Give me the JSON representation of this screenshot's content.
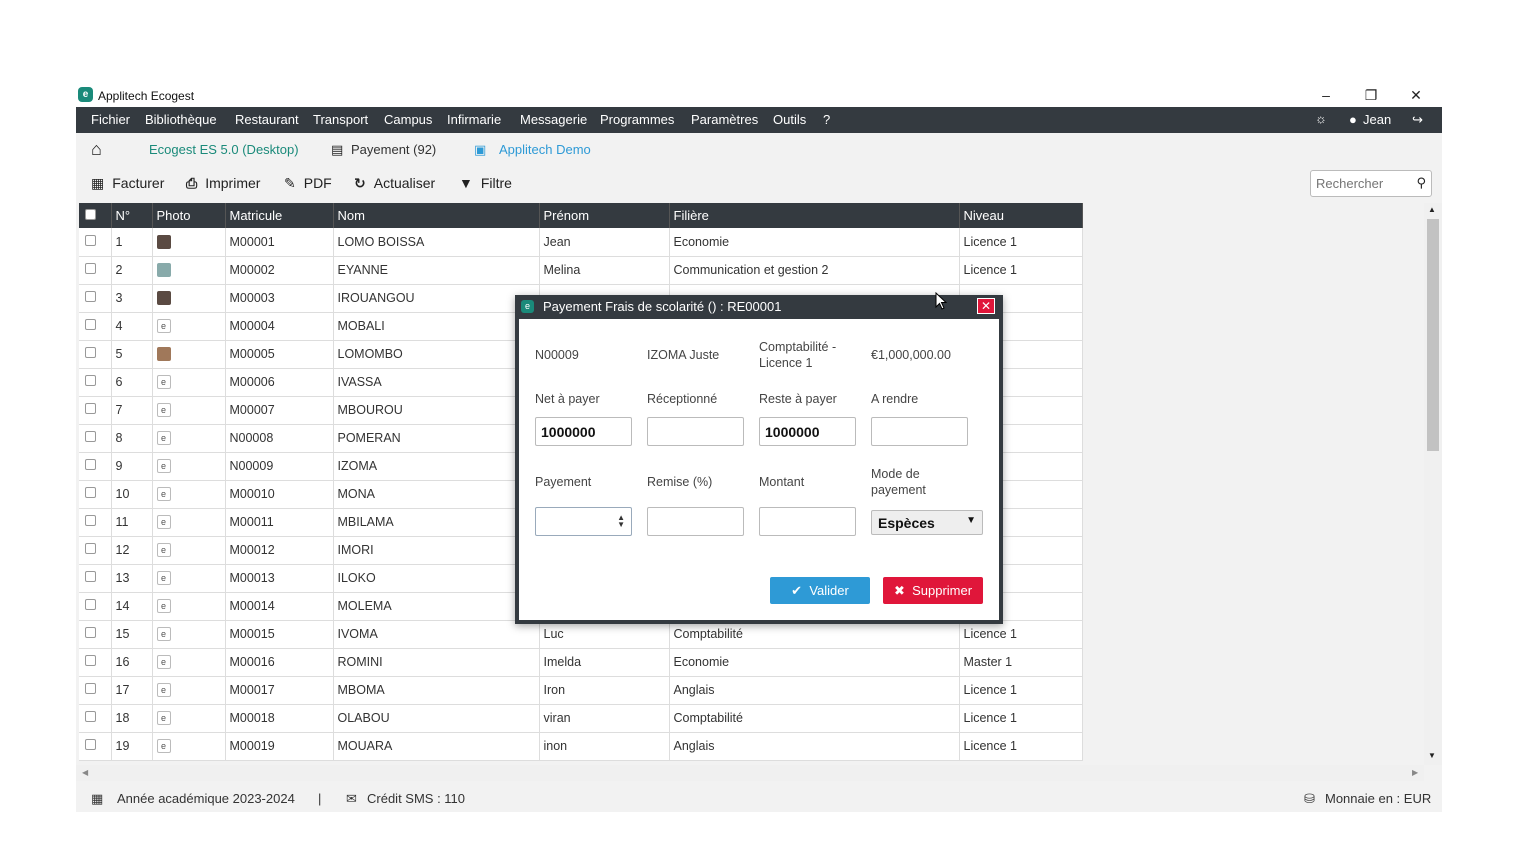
{
  "window": {
    "title": "Applitech Ecogest",
    "icon": "app-logo-icon",
    "controls": [
      "minimize-icon",
      "restore-icon",
      "close-icon"
    ]
  },
  "menu": {
    "items": [
      "Fichier",
      "Bibliothèque",
      "Restaurant",
      "Transport",
      "Campus",
      "Infirmarie",
      "Messagerie",
      "Programmes",
      "Paramètres",
      "Outils",
      "?"
    ],
    "user": "Jean"
  },
  "breadcrumbs": {
    "app": "Ecogest ES 5.0 (Desktop)",
    "section": "Payement (92)",
    "org": "Applitech Demo"
  },
  "toolbar": {
    "facturer": "Facturer",
    "imprimer": "Imprimer",
    "pdf": "PDF",
    "actualiser": "Actualiser",
    "filtre": "Filtre",
    "search_placeholder": "Rechercher"
  },
  "table": {
    "headers": [
      "N°",
      "Photo",
      "Matricule",
      "Nom",
      "Prénom",
      "Filière",
      "Niveau"
    ],
    "rows": [
      {
        "n": "1",
        "photo": "a",
        "matricule": "M00001",
        "nom": "LOMO BOISSA",
        "prenom": "Jean",
        "filiere": "Economie",
        "niveau": "Licence 1"
      },
      {
        "n": "2",
        "photo": "b",
        "matricule": "M00002",
        "nom": "EYANNE",
        "prenom": "Melina",
        "filiere": "Communication et gestion 2",
        "niveau": "Licence 1"
      },
      {
        "n": "3",
        "photo": "a",
        "matricule": "M00003",
        "nom": "IROUANGOU",
        "prenom": "",
        "filiere": "",
        "niveau": ""
      },
      {
        "n": "4",
        "photo": "d",
        "matricule": "M00004",
        "nom": "MOBALI",
        "prenom": "",
        "filiere": "",
        "niveau": ""
      },
      {
        "n": "5",
        "photo": "c",
        "matricule": "M00005",
        "nom": "LOMOMBO",
        "prenom": "",
        "filiere": "",
        "niveau": ""
      },
      {
        "n": "6",
        "photo": "d",
        "matricule": "M00006",
        "nom": "IVASSA",
        "prenom": "",
        "filiere": "",
        "niveau": ""
      },
      {
        "n": "7",
        "photo": "d",
        "matricule": "M00007",
        "nom": "MBOUROU",
        "prenom": "",
        "filiere": "",
        "niveau": ""
      },
      {
        "n": "8",
        "photo": "d",
        "matricule": "N00008",
        "nom": "POMERAN",
        "prenom": "",
        "filiere": "",
        "niveau": ""
      },
      {
        "n": "9",
        "photo": "d",
        "matricule": "N00009",
        "nom": "IZOMA",
        "prenom": "",
        "filiere": "",
        "niveau": ""
      },
      {
        "n": "10",
        "photo": "d",
        "matricule": "M00010",
        "nom": "MONA",
        "prenom": "",
        "filiere": "",
        "niveau": ""
      },
      {
        "n": "11",
        "photo": "d",
        "matricule": "M00011",
        "nom": "MBILAMA",
        "prenom": "",
        "filiere": "",
        "niveau": ""
      },
      {
        "n": "12",
        "photo": "d",
        "matricule": "M00012",
        "nom": "IMORI",
        "prenom": "",
        "filiere": "",
        "niveau": ""
      },
      {
        "n": "13",
        "photo": "d",
        "matricule": "M00013",
        "nom": "ILOKO",
        "prenom": "",
        "filiere": "",
        "niveau": ""
      },
      {
        "n": "14",
        "photo": "d",
        "matricule": "M00014",
        "nom": "MOLEMA",
        "prenom": "",
        "filiere": "",
        "niveau": ""
      },
      {
        "n": "15",
        "photo": "d",
        "matricule": "M00015",
        "nom": "IVOMA",
        "prenom": "Luc",
        "filiere": "Comptabilité",
        "niveau": "Licence 1"
      },
      {
        "n": "16",
        "photo": "d",
        "matricule": "M00016",
        "nom": "ROMINI",
        "prenom": "Imelda",
        "filiere": "Economie",
        "niveau": "Master 1"
      },
      {
        "n": "17",
        "photo": "d",
        "matricule": "M00017",
        "nom": "MBOMA",
        "prenom": "Iron",
        "filiere": "Anglais",
        "niveau": "Licence 1"
      },
      {
        "n": "18",
        "photo": "d",
        "matricule": "M00018",
        "nom": "OLABOU",
        "prenom": "viran",
        "filiere": "Comptabilité",
        "niveau": "Licence 1"
      },
      {
        "n": "19",
        "photo": "d",
        "matricule": "M00019",
        "nom": "MOUARA",
        "prenom": "inon",
        "filiere": "Anglais",
        "niveau": "Licence 1"
      }
    ]
  },
  "status": {
    "annee": "Année académique 2023-2024",
    "sep": "|",
    "sms": "Crédit SMS : 110",
    "monnaie": "Monnaie en : EUR"
  },
  "dialog": {
    "title": "Payement Frais de scolarité () : RE00001",
    "matricule": "N00009",
    "etudiant": "IZOMA Juste",
    "filiere": "Comptabilité - Licence 1",
    "montant_total": "€1,000,000.00",
    "labels": {
      "net": "Net à payer",
      "recu": "Réceptionné",
      "reste": "Reste à payer",
      "rendre": "A rendre",
      "payement": "Payement",
      "remise": "Remise (%)",
      "montant": "Montant",
      "mode": "Mode de payement"
    },
    "values": {
      "net": "1000000",
      "recu": "",
      "reste": "1000000",
      "rendre": "",
      "payement": "",
      "remise": "",
      "montant": "",
      "mode": "Espèces"
    },
    "valider": "Valider",
    "supprimer": "Supprimer"
  }
}
